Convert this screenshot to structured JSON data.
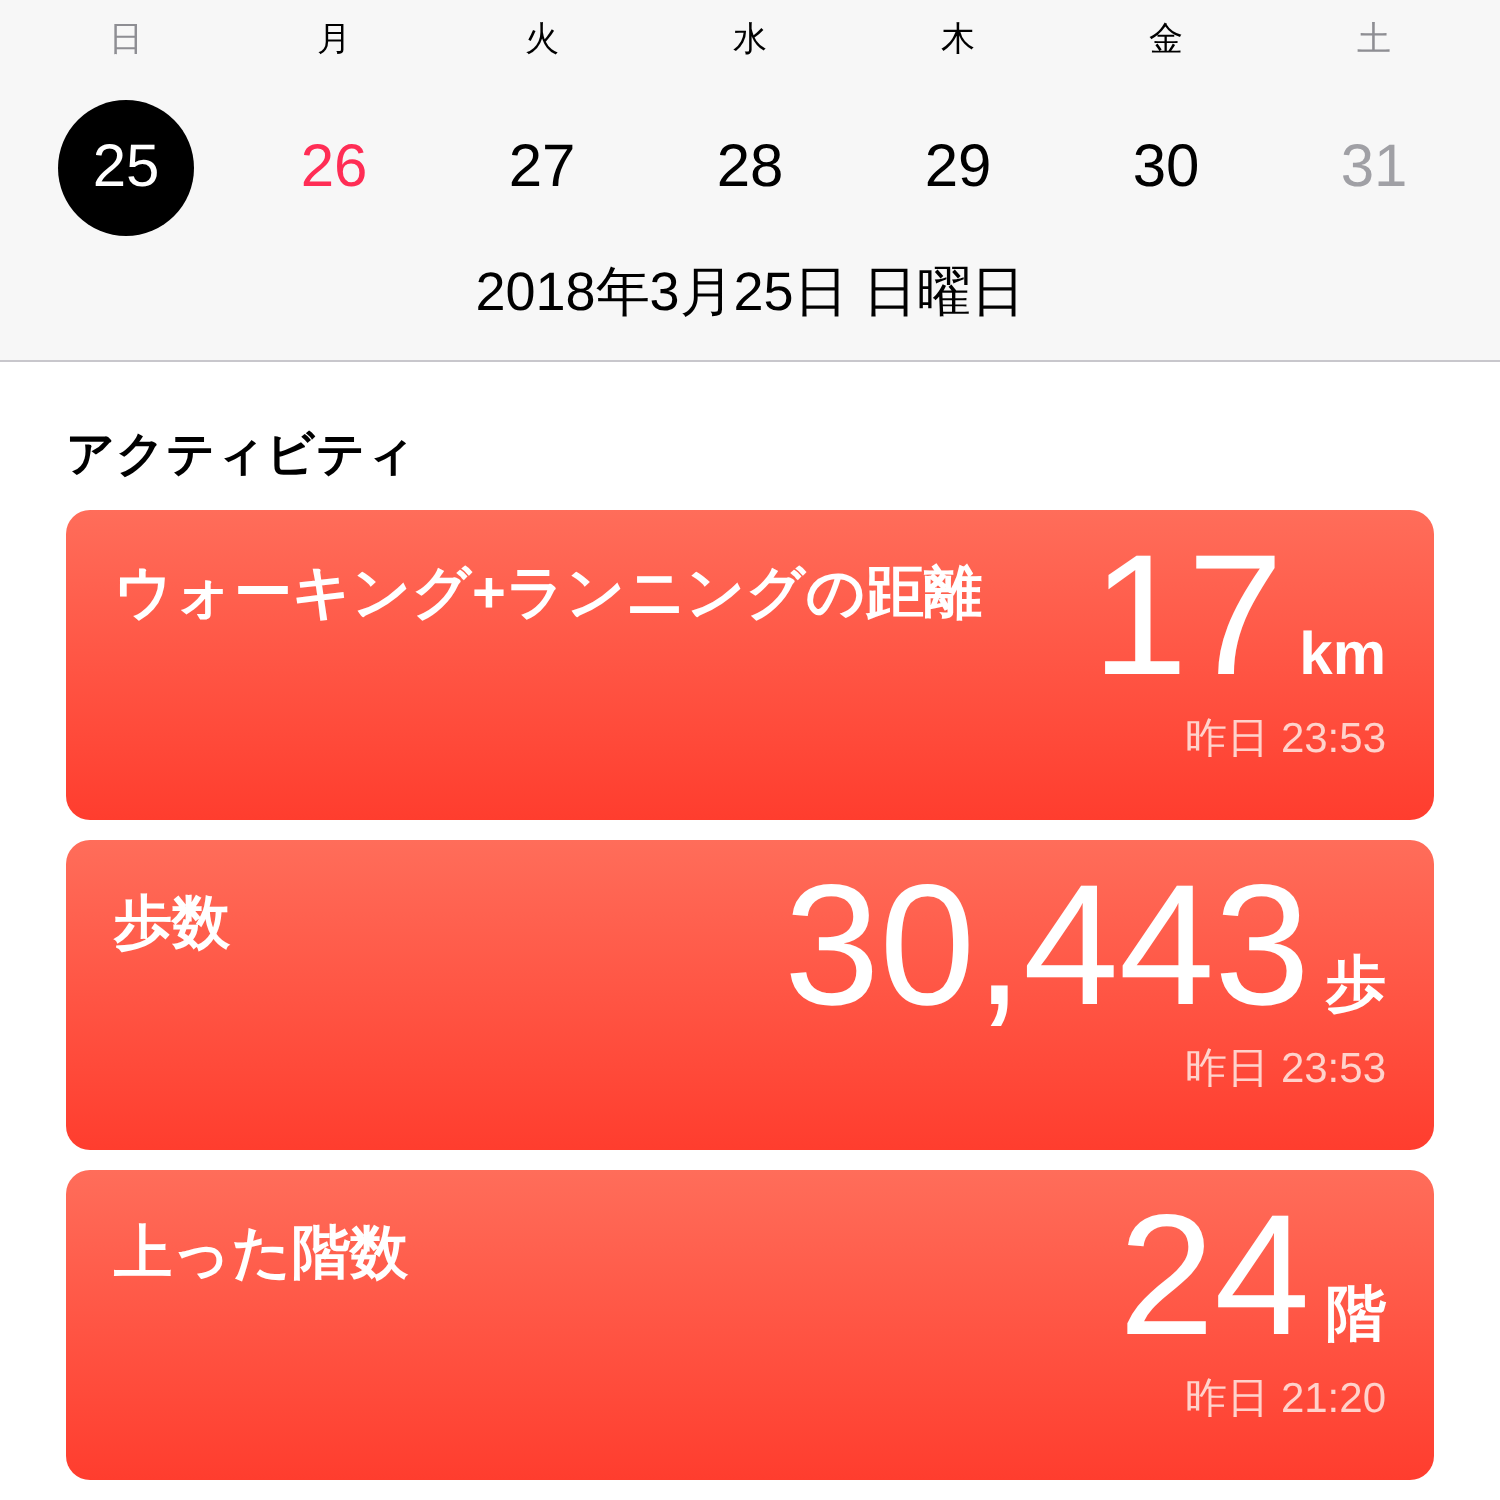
{
  "week": [
    {
      "weekday": "日",
      "weekend": true,
      "day": "25",
      "selected": true,
      "today": false,
      "future": false
    },
    {
      "weekday": "月",
      "weekend": false,
      "day": "26",
      "selected": false,
      "today": true,
      "future": false
    },
    {
      "weekday": "火",
      "weekend": false,
      "day": "27",
      "selected": false,
      "today": false,
      "future": false
    },
    {
      "weekday": "水",
      "weekend": false,
      "day": "28",
      "selected": false,
      "today": false,
      "future": false
    },
    {
      "weekday": "木",
      "weekend": false,
      "day": "29",
      "selected": false,
      "today": false,
      "future": false
    },
    {
      "weekday": "金",
      "weekend": false,
      "day": "30",
      "selected": false,
      "today": false,
      "future": false
    },
    {
      "weekday": "土",
      "weekend": true,
      "day": "31",
      "selected": false,
      "today": false,
      "future": true
    }
  ],
  "date_label": "2018年3月25日 日曜日",
  "section_title": "アクティビティ",
  "cards": [
    {
      "title": "ウォーキング+ランニングの距離",
      "value": "17",
      "unit": "km",
      "time": "昨日 23:53"
    },
    {
      "title": "歩数",
      "value": "30,443",
      "unit": "歩",
      "time": "昨日 23:53"
    },
    {
      "title": "上った階数",
      "value": "24",
      "unit": "階",
      "time": "昨日 21:20"
    }
  ]
}
